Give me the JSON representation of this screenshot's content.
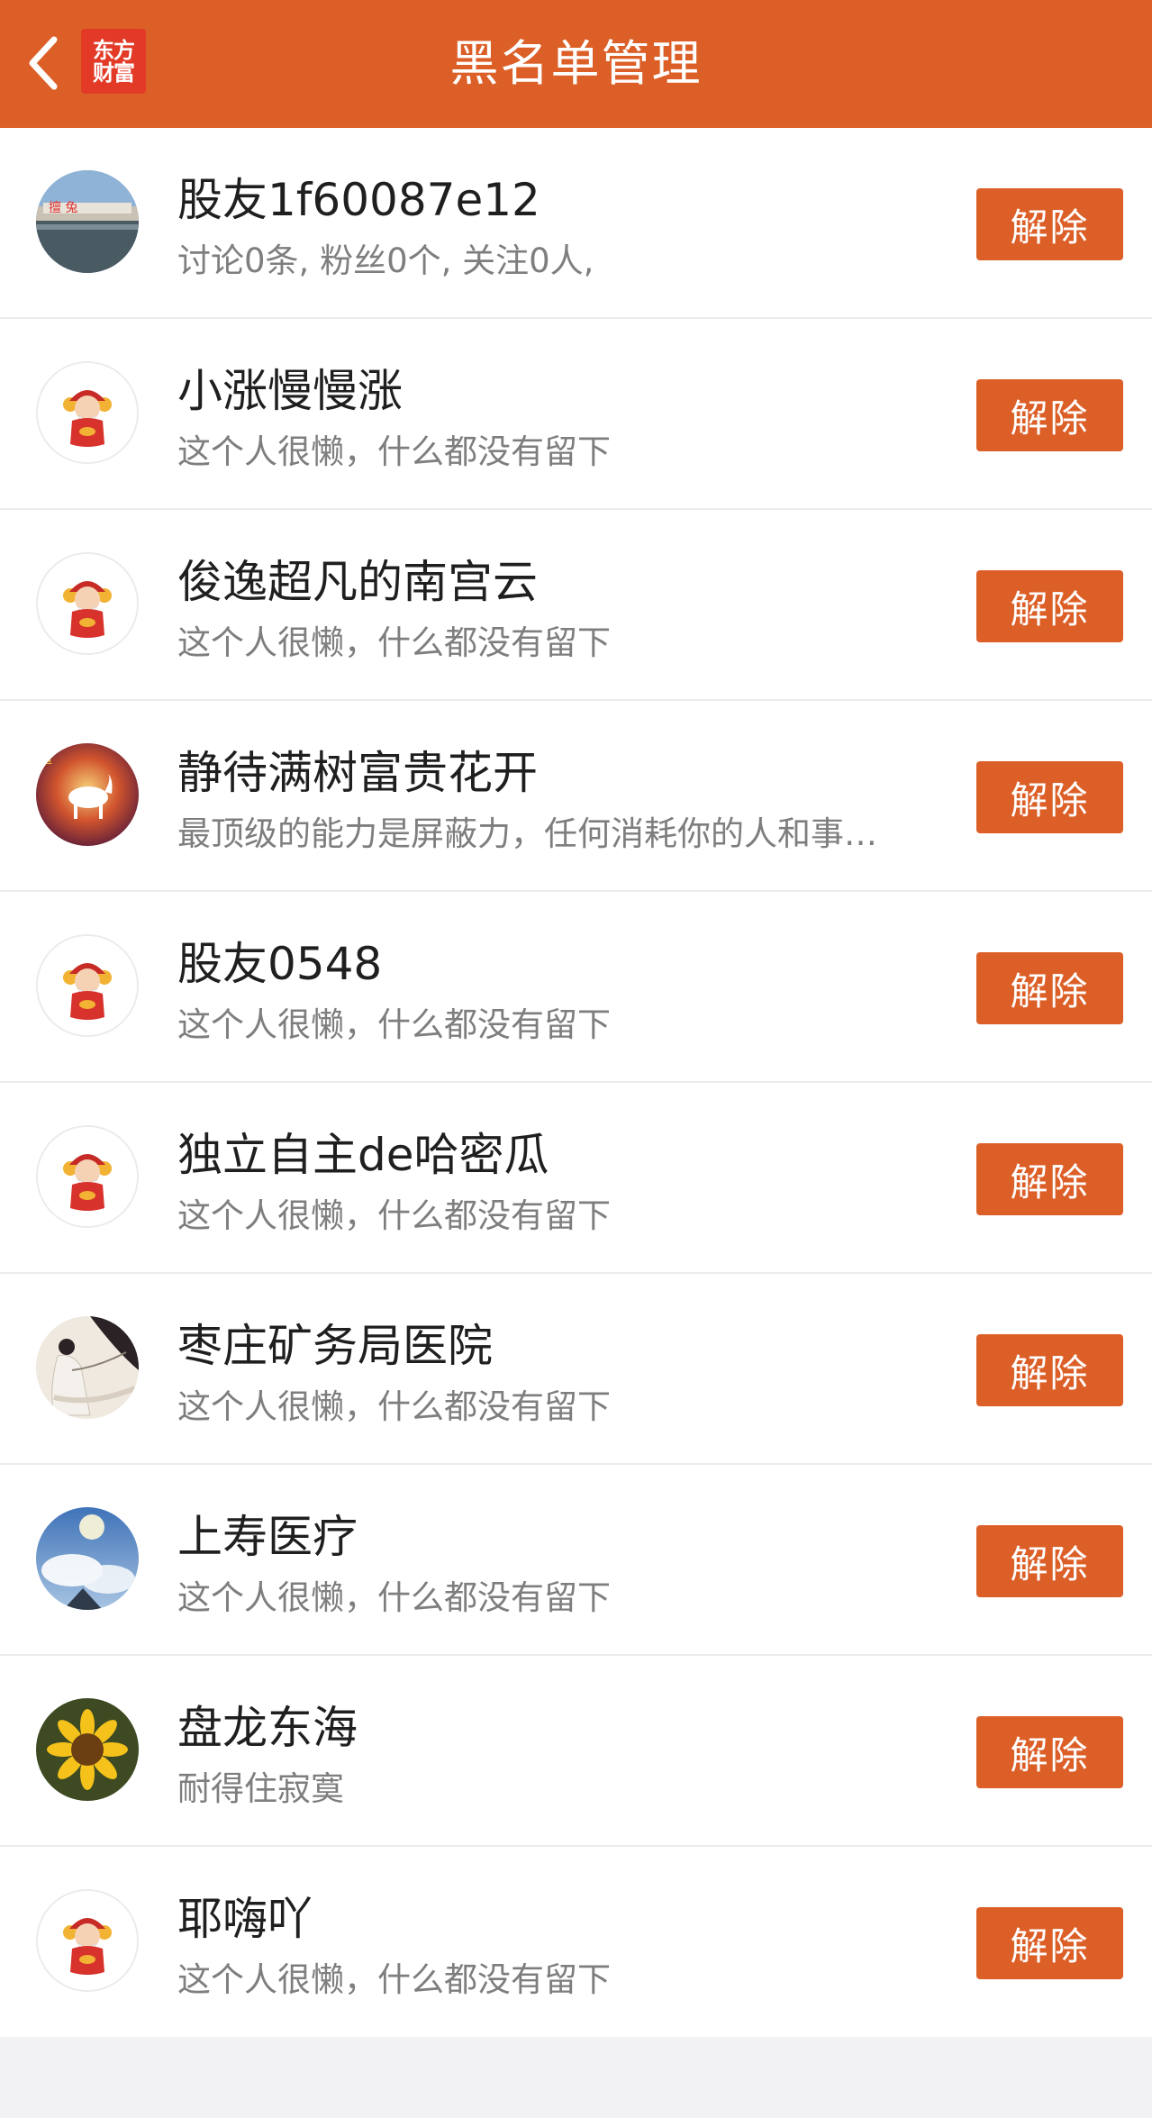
{
  "header": {
    "title": "黑名单管理",
    "logo_line1": "东方",
    "logo_line2": "财富",
    "back_icon": "chevron-left-icon"
  },
  "colors": {
    "accent": "#dc5f28",
    "logo_red": "#e23a26",
    "background": "#f2f2f4"
  },
  "list": {
    "items": [
      {
        "name": "股友1f60087e12",
        "desc": "讨论0条, 粉丝0个, 关注0人,",
        "button": "解除",
        "avatar": "photo-avatar"
      },
      {
        "name": "小涨慢慢涨",
        "desc": "这个人很懒，什么都没有留下",
        "button": "解除",
        "avatar": "god-of-wealth-avatar"
      },
      {
        "name": "俊逸超凡的南宫云",
        "desc": "这个人很懒，什么都没有留下",
        "button": "解除",
        "avatar": "god-of-wealth-avatar"
      },
      {
        "name": "静待满树富贵花开",
        "desc": "最顶级的能力是屏蔽力，任何消耗你的人和事…",
        "button": "解除",
        "avatar": "horse-photo-avatar"
      },
      {
        "name": "股友0548",
        "desc": "这个人很懒，什么都没有留下",
        "button": "解除",
        "avatar": "god-of-wealth-avatar"
      },
      {
        "name": "独立自主de哈密瓜",
        "desc": "这个人很懒，什么都没有留下",
        "button": "解除",
        "avatar": "god-of-wealth-avatar"
      },
      {
        "name": "枣庄矿务局医院",
        "desc": "这个人很懒，什么都没有留下",
        "button": "解除",
        "avatar": "painting-avatar"
      },
      {
        "name": "上寿医疗",
        "desc": "这个人很懒，什么都没有留下",
        "button": "解除",
        "avatar": "sky-photo-avatar"
      },
      {
        "name": "盘龙东海",
        "desc": "耐得住寂寞",
        "button": "解除",
        "avatar": "sunflower-photo-avatar"
      },
      {
        "name": "耶嗨吖",
        "desc": "这个人很懒，什么都没有留下",
        "button": "解除",
        "avatar": "god-of-wealth-avatar"
      }
    ]
  }
}
